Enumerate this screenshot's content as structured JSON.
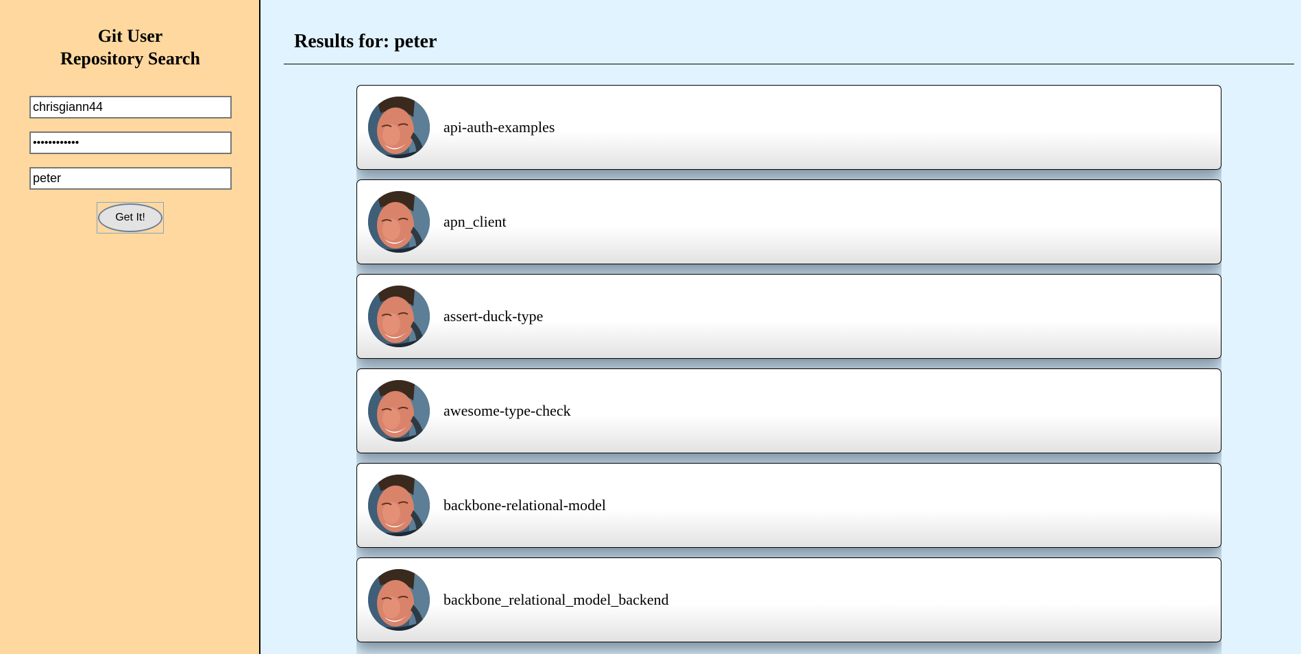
{
  "sidebar": {
    "title_line1": "Git User",
    "title_line2": "Repository Search",
    "username": "chrisgiann44",
    "password": "••••••••••••",
    "query": "peter",
    "submit_label": "Get It!"
  },
  "results": {
    "title": "Results for: peter",
    "repos": [
      {
        "name": "api-auth-examples"
      },
      {
        "name": "apn_client"
      },
      {
        "name": "assert-duck-type"
      },
      {
        "name": "awesome-type-check"
      },
      {
        "name": "backbone-relational-model"
      },
      {
        "name": "backbone_relational_model_backend"
      }
    ]
  },
  "colors": {
    "sidebar_bg": "#fed89e",
    "main_bg": "#e1f3fe"
  }
}
